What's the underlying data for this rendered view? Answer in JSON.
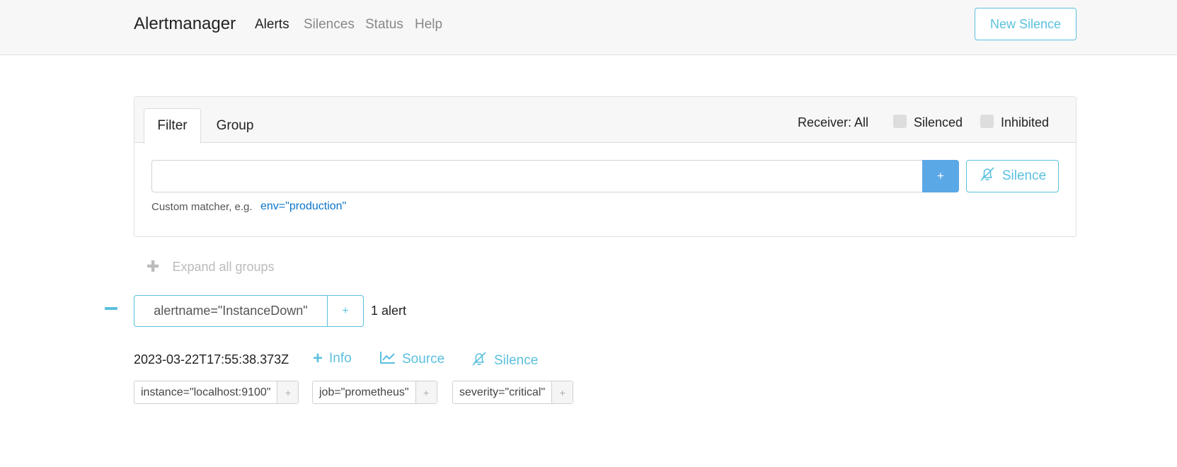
{
  "navbar": {
    "brand": "Alertmanager",
    "links": [
      {
        "label": "Alerts",
        "active": true
      },
      {
        "label": "Silences",
        "active": false
      },
      {
        "label": "Status",
        "active": false
      },
      {
        "label": "Help",
        "active": false
      }
    ],
    "new_silence_label": "New Silence"
  },
  "filter_card": {
    "tabs": [
      {
        "label": "Filter",
        "active": true
      },
      {
        "label": "Group",
        "active": false
      }
    ],
    "receiver_label": "Receiver: All",
    "silenced_label": "Silenced",
    "silenced_checked": false,
    "inhibited_label": "Inhibited",
    "inhibited_checked": false,
    "input_value": "",
    "add_button_label": "+",
    "silence_button_label": "Silence",
    "hint_text": "Custom matcher, e.g.",
    "hint_example": "env=\"production\""
  },
  "expand_all_label": "Expand all groups",
  "group": {
    "label": "alertname=\"InstanceDown\"",
    "add_label": "+",
    "count_text": "1 alert"
  },
  "alert": {
    "timestamp": "2023-03-22T17:55:38.373Z",
    "info_label": "Info",
    "source_label": "Source",
    "silence_label": "Silence",
    "labels": [
      {
        "text": "instance=\"localhost:9100\"",
        "add": "+"
      },
      {
        "text": "job=\"prometheus\"",
        "add": "+"
      },
      {
        "text": "severity=\"critical\"",
        "add": "+"
      }
    ]
  },
  "colors": {
    "accent": "#5bc0de",
    "primary": "#5ba8e6",
    "link": "#0b74c9",
    "navbar_bg": "#f7f7f7"
  },
  "icons": {
    "silence": "bell-slash-icon",
    "source": "chart-line-icon",
    "info": "plus-icon",
    "collapse": "minus-icon",
    "expand": "plus-icon"
  }
}
